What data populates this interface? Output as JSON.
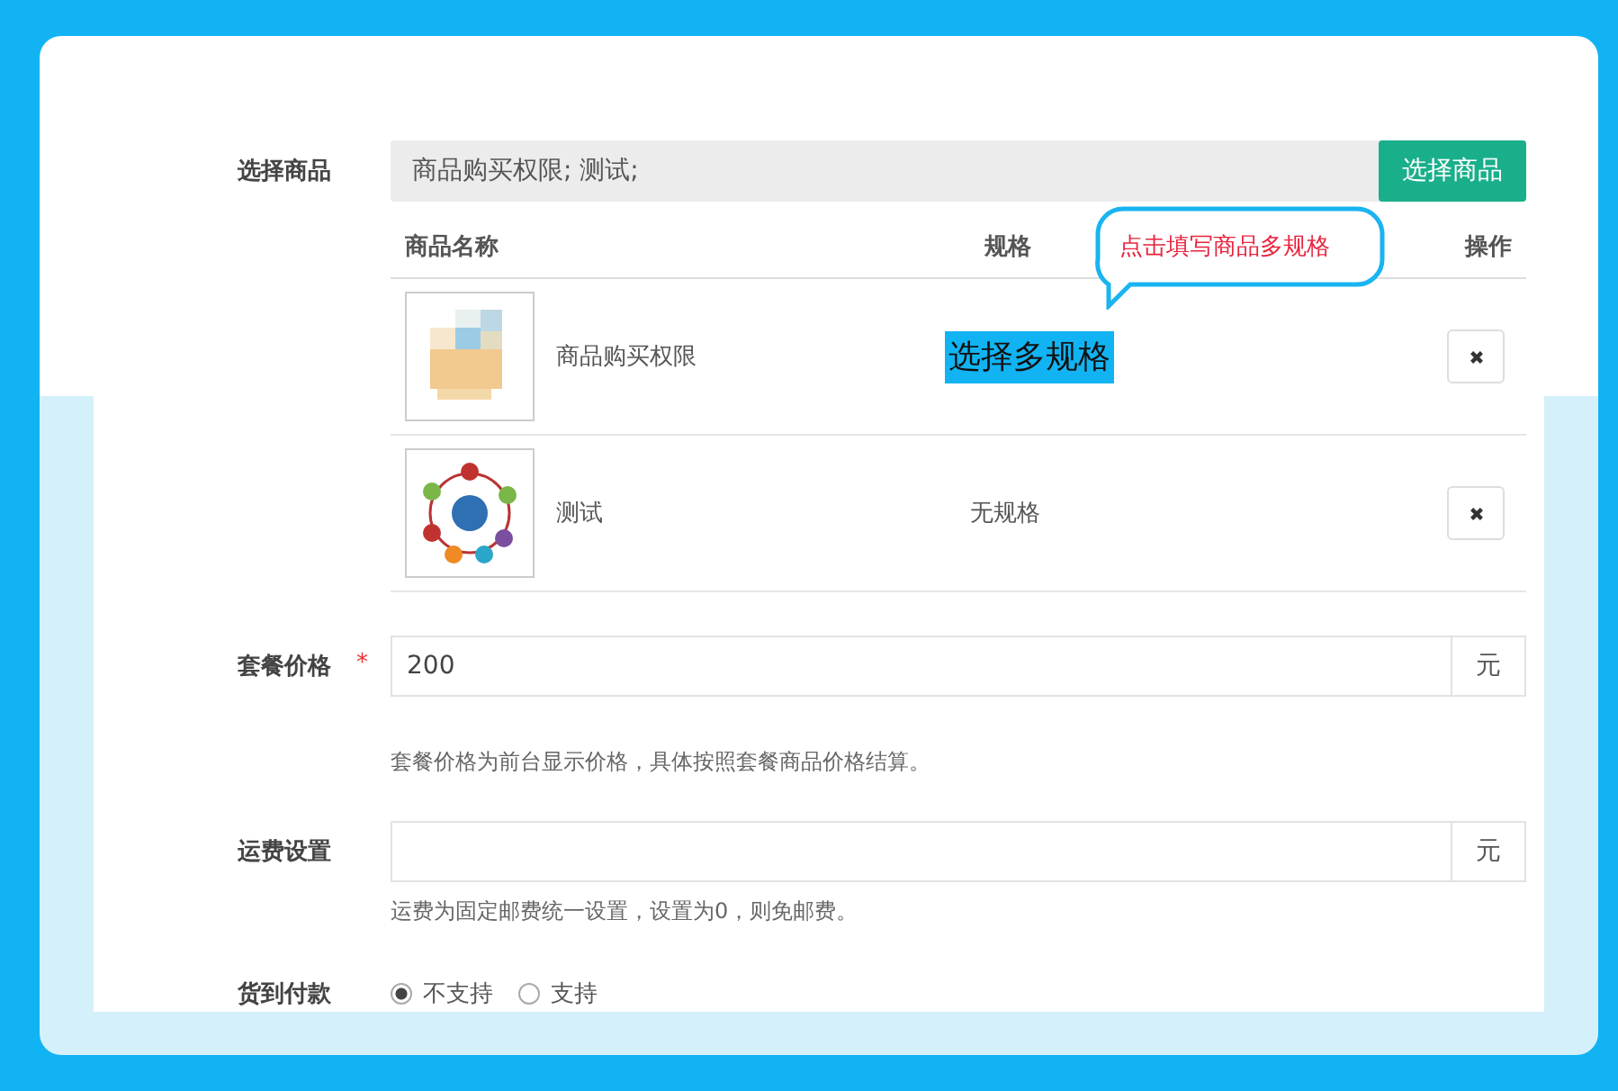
{
  "goods_field": {
    "label": "选择商品",
    "value": "商品购买权限; 测试;",
    "button": "选择商品"
  },
  "table": {
    "columns": [
      "商品名称",
      "规格",
      "操作"
    ],
    "rows": [
      {
        "thumb": {
          "kind": "blurred"
        },
        "name": "商品购买权限",
        "spec": "选择多规格",
        "kind": "link"
      },
      {
        "thumb": {
          "kind": "diagram"
        },
        "name": "测试",
        "spec": "无规格",
        "kind": "text"
      }
    ]
  },
  "callout": {
    "text": "点击填写商品多规格"
  },
  "price": {
    "label": "套餐价格",
    "required_mark": "*",
    "value": "200",
    "unit": "元",
    "help": "套餐价格为前台显示价格，具体按照套餐商品价格结算。"
  },
  "shipping": {
    "label": "运费设置",
    "unit": "元",
    "help": "运费为固定邮费统一设置，设置为0，则免邮费。"
  },
  "cod": {
    "label": "货到付款",
    "options": [
      {
        "label": "不支持",
        "selected": true
      },
      {
        "label": "支持",
        "selected": false
      }
    ]
  }
}
